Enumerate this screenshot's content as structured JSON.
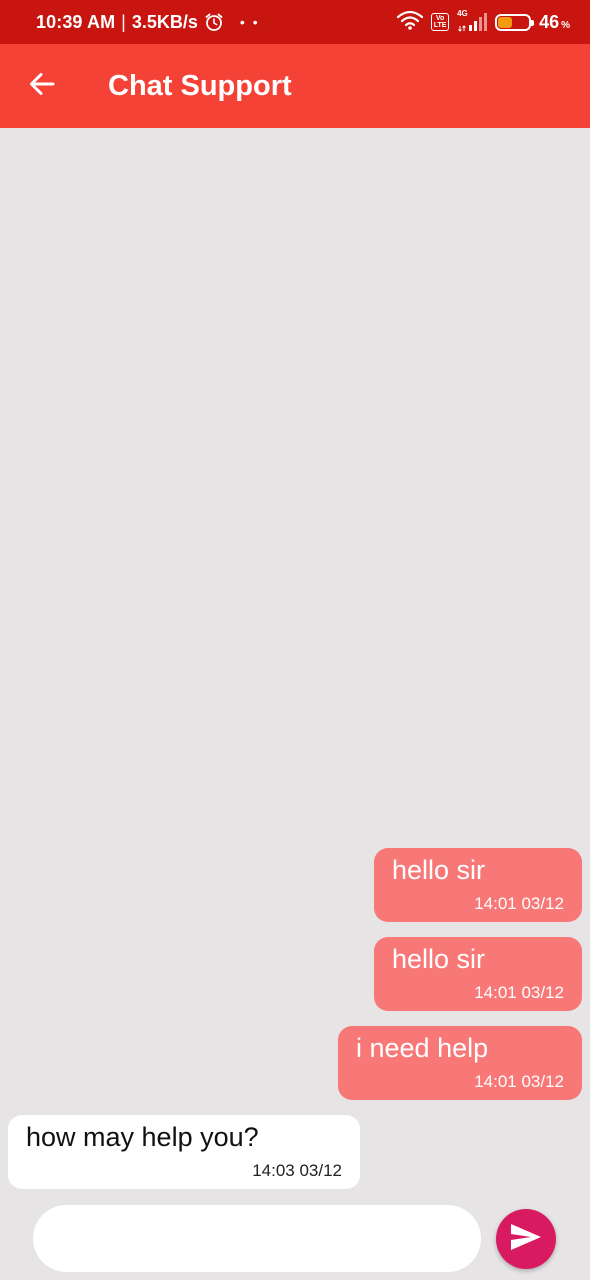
{
  "status_bar": {
    "time": "10:39 AM",
    "separator": "|",
    "network_speed": "3.5KB/s",
    "dots": "• •",
    "volte_top": "Vo",
    "volte_bottom": "LTE",
    "network_type": "4G",
    "battery_level": "46",
    "battery_unit": "%",
    "battery_fraction": 0.46,
    "battery_color": "#f39c12"
  },
  "app_bar": {
    "title": "Chat Support",
    "back_icon": "arrow-back-icon",
    "color": "#f44336"
  },
  "messages": [
    {
      "direction": "sent",
      "text": "hello sir",
      "time": "14:01 03/12"
    },
    {
      "direction": "sent",
      "text": "hello sir",
      "time": "14:01 03/12"
    },
    {
      "direction": "sent",
      "text": "i need help",
      "time": "14:01 03/12"
    },
    {
      "direction": "received",
      "text": "how may help you?",
      "time": "14:03 03/12"
    }
  ],
  "input": {
    "value": "",
    "placeholder": ""
  },
  "send_button": {
    "icon": "send-icon",
    "color": "#d81b60"
  }
}
